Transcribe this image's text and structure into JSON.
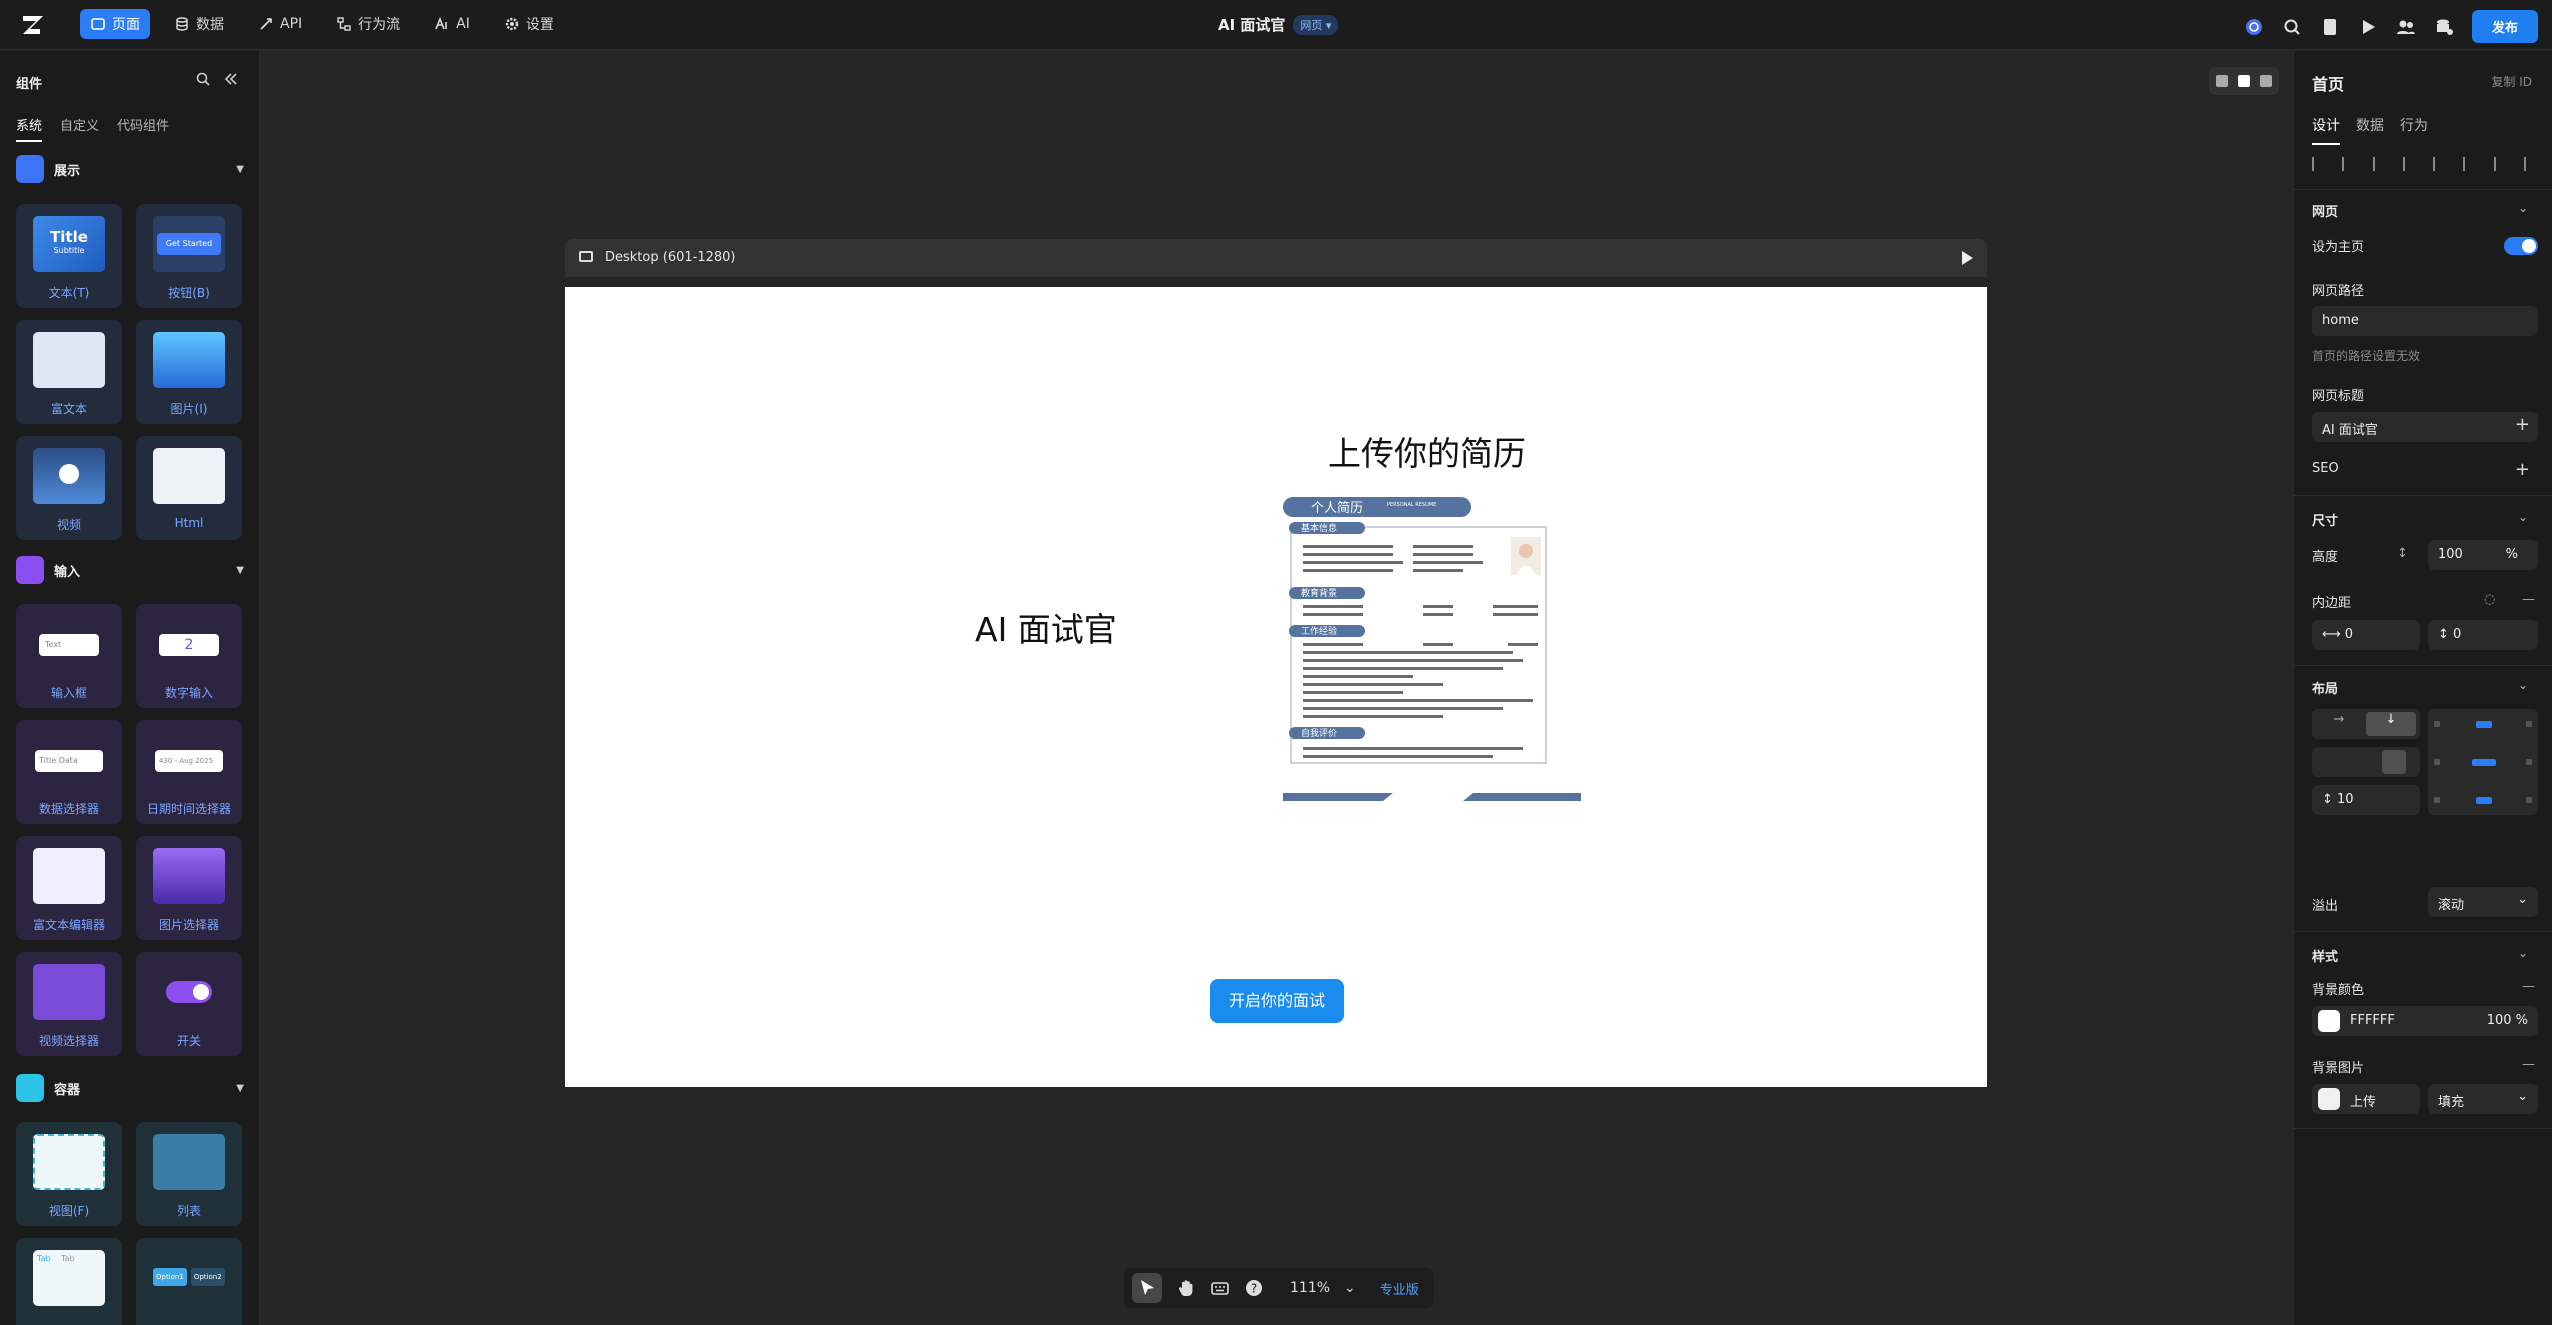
{
  "topbar": {
    "nav": [
      {
        "label": "页面",
        "icon": "page-icon"
      },
      {
        "label": "数据",
        "icon": "database-icon"
      },
      {
        "label": "API",
        "icon": "api-icon"
      },
      {
        "label": "行为流",
        "icon": "flow-icon"
      },
      {
        "label": "AI",
        "icon": "ai-icon"
      },
      {
        "label": "设置",
        "icon": "gear-icon"
      }
    ],
    "app_title": "AI 面试官",
    "page_type_badge": "网页",
    "publish_label": "发布"
  },
  "left_panel": {
    "title": "组件",
    "tabs": [
      "系统",
      "自定义",
      "代码组件"
    ],
    "sections": {
      "display": {
        "label": "展示",
        "items": [
          "文本(T)",
          "按钮(B)",
          "富文本",
          "图片(I)",
          "视频",
          "Html"
        ]
      },
      "input": {
        "label": "输入",
        "items": [
          "输入框",
          "数字输入",
          "数据选择器",
          "日期时间选择器",
          "富文本编辑器",
          "图片选择器",
          "视频选择器",
          "开关"
        ]
      },
      "container": {
        "label": "容器",
        "items": [
          "视图(F)",
          "列表"
        ]
      }
    },
    "thumb_text": {
      "title": "Title",
      "subtitle": "Subtitle",
      "get_started": "Get Started",
      "text_input": "Text",
      "number_value": "2",
      "data_title": "Title",
      "data_select": "Data",
      "date_range": "430 - Aug 2025",
      "tab_a": "Tab",
      "tab_b": "Tab",
      "option1": "Option1",
      "option2": "Option2"
    }
  },
  "canvas": {
    "device_label": "Desktop (601-1280)",
    "page": {
      "left_heading": "AI 面试官",
      "right_heading": "上传你的简历",
      "start_button": "开启你的面试"
    },
    "resume": {
      "title": "个人简历",
      "title_en": "PERSONAL RESUME",
      "sections": [
        "基本信息",
        "教育背景",
        "工作经验",
        "自我评价"
      ]
    },
    "zoom": "111%",
    "pro_label": "专业版"
  },
  "right_panel": {
    "title": "首页",
    "copy_id": "复制 ID",
    "tabs": [
      "设计",
      "数据",
      "行为"
    ],
    "webpage_section": "网页",
    "set_home": "设为主页",
    "path_label": "网页路径",
    "path_value": "home",
    "path_hint": "首页的路径设置无效",
    "page_title_label": "网页标题",
    "page_title_value": "AI 面试官",
    "seo": "SEO",
    "size_section": "尺寸",
    "height_label": "高度",
    "height_value": "100",
    "height_unit": "%",
    "padding_label": "内边距",
    "padding_h": "0",
    "padding_v": "0",
    "layout_section": "布局",
    "gap_value": "10",
    "overflow_label": "溢出",
    "overflow_value": "滚动",
    "style_section": "样式",
    "bg_color_label": "背景颜色",
    "bg_color_value": "FFFFFF",
    "bg_opacity": "100 %",
    "bg_image_label": "背景图片",
    "upload_label": "上传",
    "fill_value": "填充"
  },
  "colors": {
    "accent": "#2a7df6",
    "button": "#1a8cf0"
  }
}
